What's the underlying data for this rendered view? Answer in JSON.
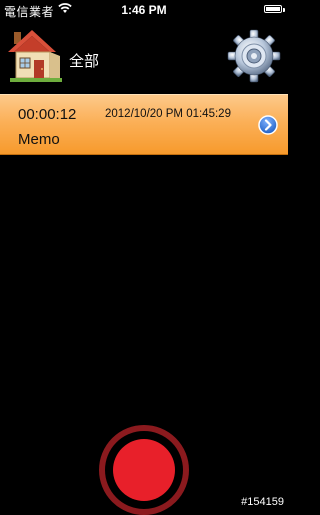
{
  "status_bar": {
    "carrier": "電信業者",
    "time": "1:46 PM",
    "wifi_icon": "wifi-icon",
    "battery_icon": "battery-icon"
  },
  "header": {
    "home_icon": "house-icon",
    "category_label": "全部",
    "settings_icon": "gear-icon"
  },
  "memos": [
    {
      "duration": "00:00:12",
      "date": "2012/10/20 PM 01:45:29",
      "title": "Memo",
      "disclosure_icon": "chevron-right-icon"
    }
  ],
  "record_button": {
    "icon": "record-icon"
  },
  "watermark": "#154159",
  "colors": {
    "background": "#000000",
    "row_gradient_top": "#fdc98a",
    "row_gradient_bottom": "#f79a2c",
    "record_red": "#e8202a",
    "record_ring": "#8b1a1e",
    "disclosure_blue": "#2a6fd6"
  }
}
